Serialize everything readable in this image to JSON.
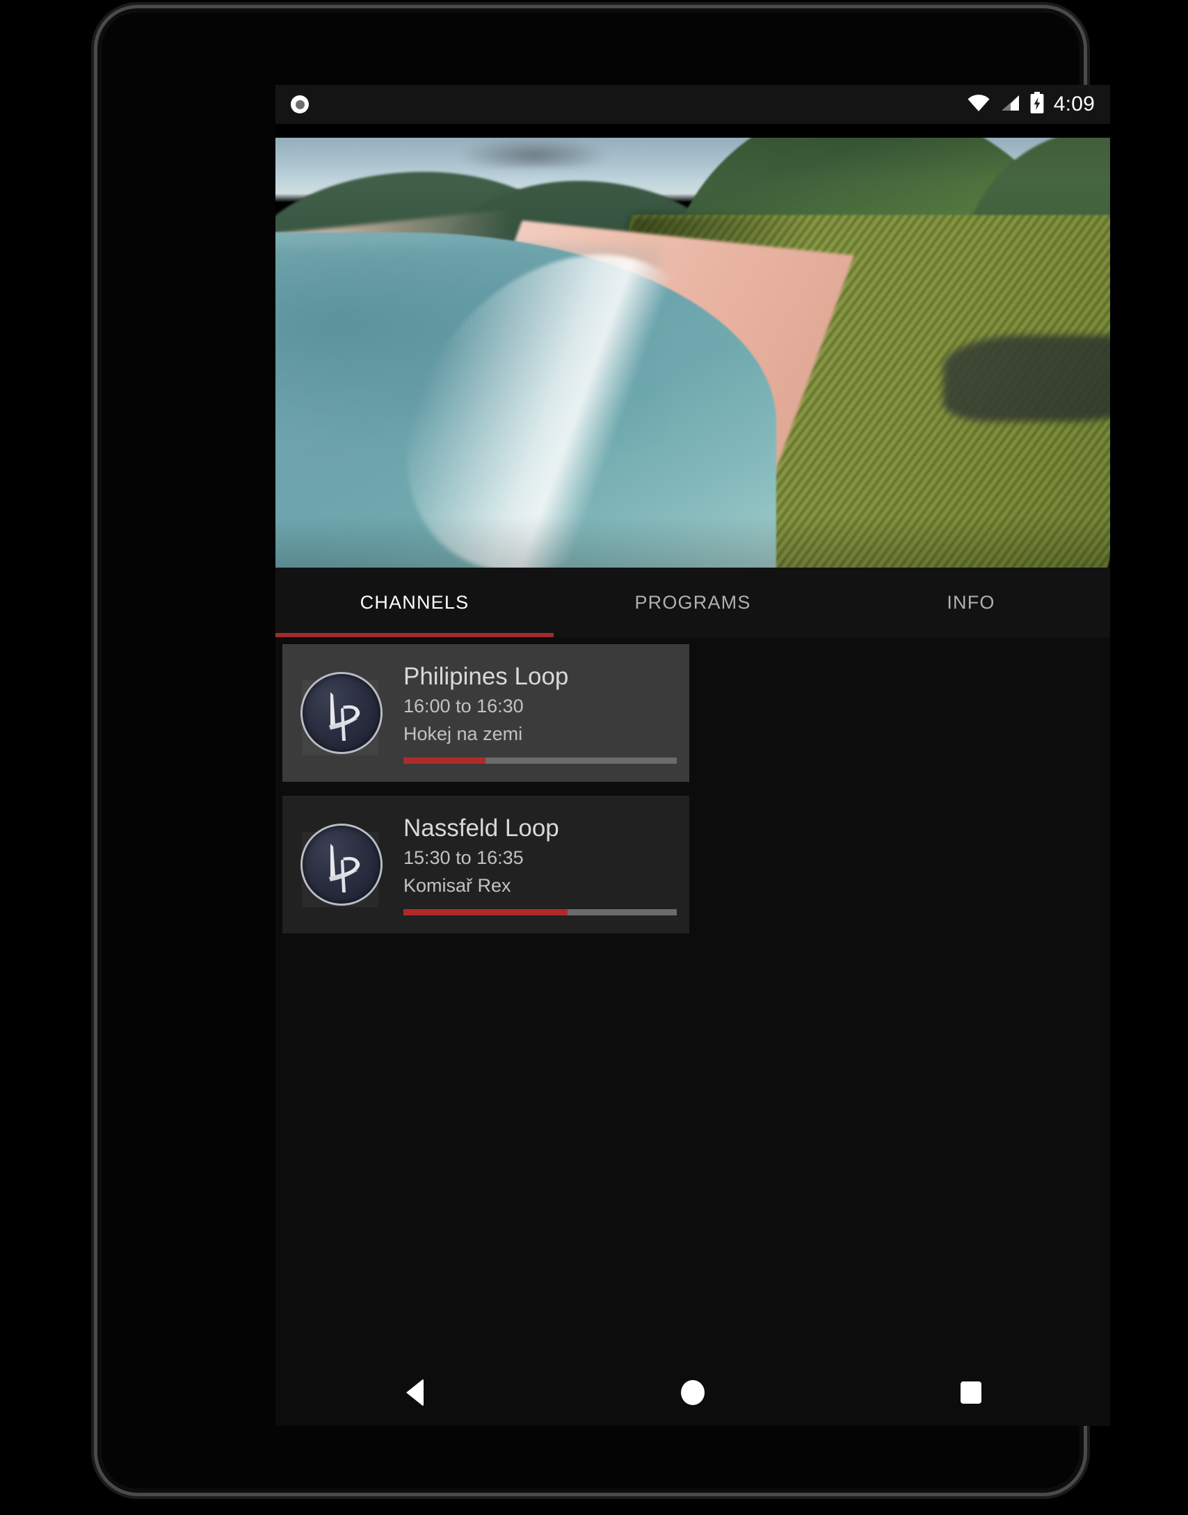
{
  "status_bar": {
    "cast_icon": "cast-circle-icon",
    "wifi_icon": "wifi-icon",
    "signal_icon": "cellular-signal-icon",
    "battery_icon": "battery-charging-icon",
    "time": "4:09"
  },
  "player": {
    "content_name": "beach-aerial-video",
    "alt": "Aerial view of a tropical beach with turquoise ocean, pink sand and palm forest"
  },
  "tabs": [
    {
      "label": "CHANNELS",
      "active": true
    },
    {
      "label": "PROGRAMS",
      "active": false
    },
    {
      "label": "INFO",
      "active": false
    }
  ],
  "channels": [
    {
      "title": "Philipines Loop",
      "time": "16:00 to 16:30",
      "program": "Hokej na zemi",
      "progress_percent": 30,
      "selected": true,
      "logo_text": "LP"
    },
    {
      "title": "Nassfeld Loop",
      "time": "15:30 to 16:35",
      "program": "Komisař Rex",
      "progress_percent": 60,
      "selected": false,
      "logo_text": "LP"
    }
  ],
  "nav_bar": {
    "back_label": "Back",
    "home_label": "Home",
    "recents_label": "Recents"
  },
  "colors": {
    "accent_red": "#a32b2b",
    "progress_red": "#b02a2a",
    "progress_track": "#6b6b6b",
    "card_selected": "#3b3b3b",
    "card_normal": "#212121",
    "tab_bar_bg": "#121212",
    "screen_bg": "#0c0c0c"
  }
}
